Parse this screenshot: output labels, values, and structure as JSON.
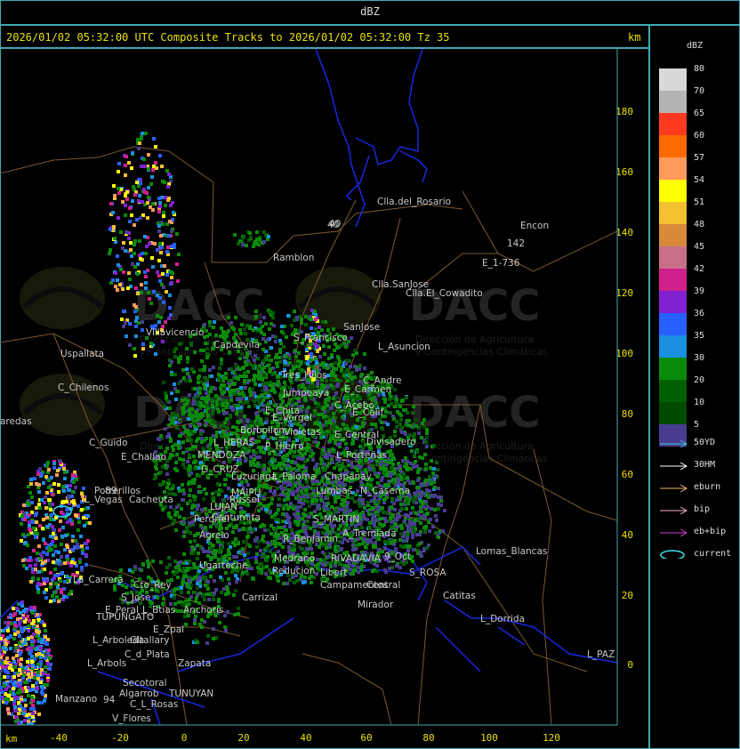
{
  "window_title": "dBZ",
  "header": "2026/01/02 05:32:00 UTC Composite Tracks to 2026/01/02 05:32:00 Tz 35",
  "axis_unit_label": "km",
  "y_ticks": [
    "180",
    "160",
    "140",
    "120",
    "100",
    "80",
    "60",
    "40",
    "20",
    "0"
  ],
  "x_ticks": [
    "-40",
    "-20",
    "0",
    "20",
    "40",
    "60",
    "80",
    "100",
    "120"
  ],
  "watermark_text": "DACC",
  "watermark_subtitle_line1": "Dirección de Agricultura",
  "watermark_subtitle_line2": "y Contingencias Climáticas",
  "legend": {
    "title": "dBZ",
    "scale": [
      {
        "value": "80",
        "color": "#d8d8d8"
      },
      {
        "value": "70",
        "color": "#b4b4b4"
      },
      {
        "value": "65",
        "color": "#ff3a1e"
      },
      {
        "value": "60",
        "color": "#ff6a00"
      },
      {
        "value": "57",
        "color": "#ff9a5a"
      },
      {
        "value": "54",
        "color": "#ffff00"
      },
      {
        "value": "51",
        "color": "#f5c030"
      },
      {
        "value": "48",
        "color": "#d88a3a"
      },
      {
        "value": "45",
        "color": "#c8708a"
      },
      {
        "value": "42",
        "color": "#d0208c"
      },
      {
        "value": "39",
        "color": "#8020d0"
      },
      {
        "value": "36",
        "color": "#2860ff"
      },
      {
        "value": "35",
        "color": "#1a90e0"
      },
      {
        "value": "30",
        "color": "#0a8a0a"
      },
      {
        "value": "20",
        "color": "#006000"
      },
      {
        "value": "10",
        "color": "#004a00"
      },
      {
        "value": "5",
        "color": "#483c90"
      }
    ],
    "tracks": [
      {
        "label": "50YD",
        "color": "#40c8d8"
      },
      {
        "label": "30HM",
        "color": "#ffffff"
      },
      {
        "label": "eburn",
        "color": "#e8b070"
      },
      {
        "label": "bip",
        "color": "#f0b0c8"
      },
      {
        "label": "eb+bip",
        "color": "#d040d0"
      },
      {
        "label": "current",
        "color": "#40e0f0"
      }
    ]
  },
  "places": [
    {
      "name": "Clla.del_Rosario"
    },
    {
      "name": "Encon"
    },
    {
      "name": "142"
    },
    {
      "name": "E_1-736"
    },
    {
      "name": "Ramblon"
    },
    {
      "name": "40"
    },
    {
      "name": "Clla.SanJose"
    },
    {
      "name": "Clla.El_Cowadito"
    },
    {
      "name": "SanJose"
    },
    {
      "name": "L_Asuncion"
    },
    {
      "name": "Villavicencio"
    },
    {
      "name": "Capdevila"
    },
    {
      "name": "S_Francisco"
    },
    {
      "name": "Uspallata"
    },
    {
      "name": "C_Chilenos"
    },
    {
      "name": "Tres_Hijos"
    },
    {
      "name": "C_Andre"
    },
    {
      "name": "E_Carmen"
    },
    {
      "name": "Jumpeaya"
    },
    {
      "name": "E_Chita"
    },
    {
      "name": "E_Vergel"
    },
    {
      "name": "C_Acebo"
    },
    {
      "name": "E_Calif"
    },
    {
      "name": "aredas"
    },
    {
      "name": "Borbollon"
    },
    {
      "name": "L_Violetas"
    },
    {
      "name": "E_Central"
    },
    {
      "name": "Divisadero"
    },
    {
      "name": "L_HERAS"
    },
    {
      "name": "P_Hierro"
    },
    {
      "name": "L_Porteñas"
    },
    {
      "name": "C_Guido"
    },
    {
      "name": "E_Challao"
    },
    {
      "name": "MENDOZA"
    },
    {
      "name": "G_CRUZ"
    },
    {
      "name": "Luzuriaga"
    },
    {
      "name": "L_Paloma"
    },
    {
      "name": "Chapanay"
    },
    {
      "name": "MAIPU"
    },
    {
      "name": "Russel"
    },
    {
      "name": "Lumbas"
    },
    {
      "name": "N_Caserna"
    },
    {
      "name": "Potrerillos"
    },
    {
      "name": "L_Vegas"
    },
    {
      "name": "Cacheuta"
    },
    {
      "name": "LUJAN"
    },
    {
      "name": "Cantumita"
    },
    {
      "name": "S_MARTIN"
    },
    {
      "name": "Perdriel"
    },
    {
      "name": "Agrelo"
    },
    {
      "name": "R_Benjamin"
    },
    {
      "name": "A_Tremiada"
    },
    {
      "name": "Lomas_Blancas"
    },
    {
      "name": "Medrano"
    },
    {
      "name": "RIVADAVIA"
    },
    {
      "name": "9_Oct"
    },
    {
      "name": "Ugarteche"
    },
    {
      "name": "Reducion"
    },
    {
      "name": "Libert"
    },
    {
      "name": "S_ROSA"
    },
    {
      "name": "La_Carrera"
    },
    {
      "name": "Cto_Rey"
    },
    {
      "name": "Campamentos"
    },
    {
      "name": "Central"
    },
    {
      "name": "S_Jose"
    },
    {
      "name": "Carrizal"
    },
    {
      "name": "Catitas"
    },
    {
      "name": "E_Peral"
    },
    {
      "name": "L_Btias"
    },
    {
      "name": "Anchoris"
    },
    {
      "name": "Mirador"
    },
    {
      "name": "TUPUNGATO"
    },
    {
      "name": "L_Dorrida"
    },
    {
      "name": "E_Zpal"
    },
    {
      "name": "L_Arboleda"
    },
    {
      "name": "Gltallary"
    },
    {
      "name": "L_PAZ"
    },
    {
      "name": "C_d_Plata"
    },
    {
      "name": "L_Arbols"
    },
    {
      "name": "Zapata"
    },
    {
      "name": "Secotoral"
    },
    {
      "name": "Algarrob"
    },
    {
      "name": "TUNUYAN"
    },
    {
      "name": "Manzano"
    },
    {
      "name": "C_L_Rosas"
    },
    {
      "name": "V_Flores"
    },
    {
      "name": "40"
    },
    {
      "name": "89"
    },
    {
      "name": "94"
    }
  ]
}
